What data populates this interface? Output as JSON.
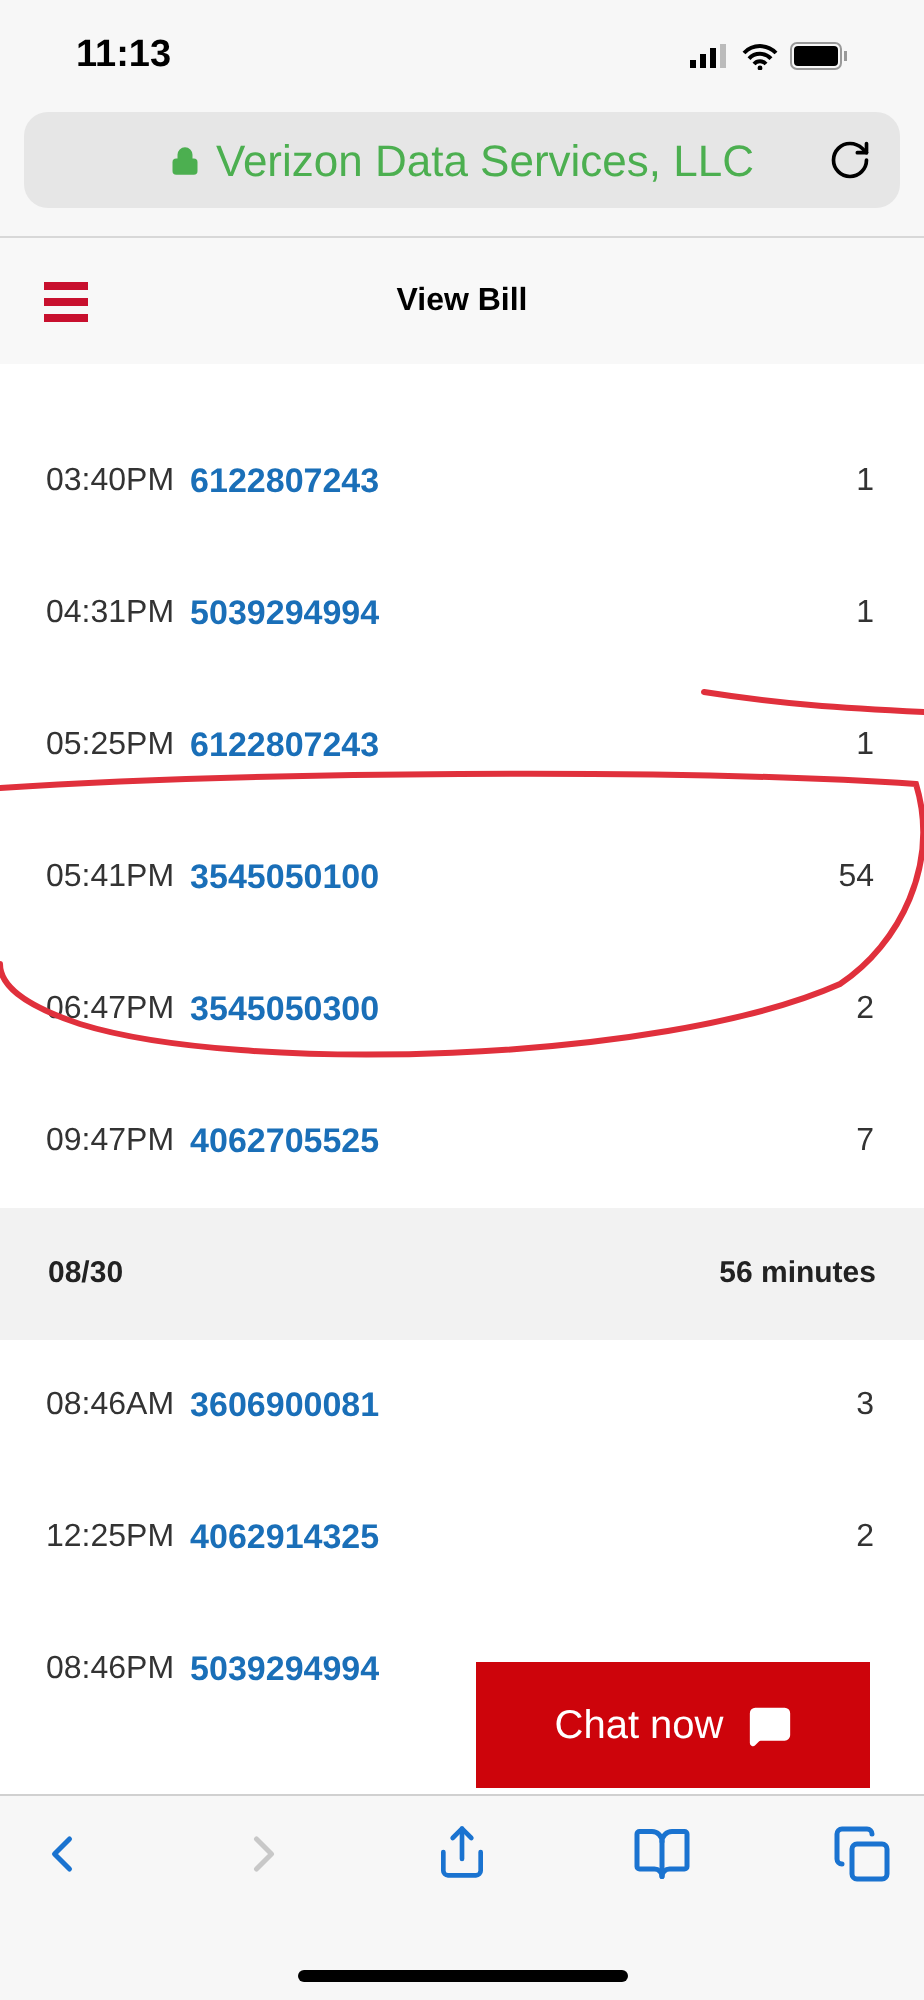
{
  "status_bar": {
    "time": "11:13"
  },
  "url_bar": {
    "site": "Verizon Data Services, LLC"
  },
  "header": {
    "title": "View Bill"
  },
  "groups": [
    {
      "rows": [
        {
          "time": "03:40PM",
          "number": "6122807243",
          "minutes": "1"
        },
        {
          "time": "04:31PM",
          "number": "5039294994",
          "minutes": "1"
        },
        {
          "time": "05:25PM",
          "number": "6122807243",
          "minutes": "1"
        },
        {
          "time": "05:41PM",
          "number": "3545050100",
          "minutes": "54"
        },
        {
          "time": "06:47PM",
          "number": "3545050300",
          "minutes": "2"
        },
        {
          "time": "09:47PM",
          "number": "4062705525",
          "minutes": "7"
        }
      ]
    },
    {
      "date": "08/30",
      "total": "56 minutes",
      "rows": [
        {
          "time": "08:46AM",
          "number": "3606900081",
          "minutes": "3"
        },
        {
          "time": "12:25PM",
          "number": "4062914325",
          "minutes": "2"
        },
        {
          "time": "08:46PM",
          "number": "5039294994"
        }
      ]
    }
  ],
  "chat_button": {
    "label": "Chat now"
  }
}
